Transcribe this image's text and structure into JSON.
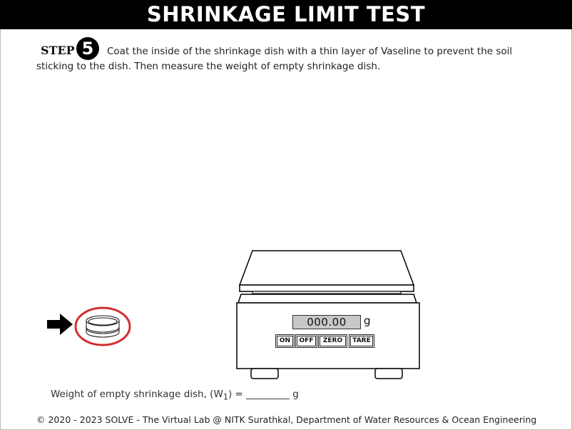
{
  "header": {
    "title": "SHRINKAGE LIMIT TEST"
  },
  "step": {
    "label": "STEP",
    "number": "5",
    "text": "Coat the inside of the shrinkage dish with a thin layer of Vaseline to prevent the soil sticking to the dish. Then measure the weight of empty shrinkage dish."
  },
  "scale": {
    "display_value": "000.00",
    "unit": "g",
    "buttons": {
      "on": "ON",
      "off": "OFF",
      "zero": "ZERO",
      "tare": "TARE"
    }
  },
  "weight": {
    "label": "Weight of empty shrinkage dish, (W",
    "subscript": "1",
    "equals": ") = ",
    "blank": "_________",
    "unit": " g"
  },
  "footer": {
    "text": "© 2020 - 2023 SOLVE - The Virtual Lab @ NITK Surathkal, Department of Water Resources & Ocean Engineering"
  },
  "colors": {
    "highlight_ring": "#d32f2f",
    "display_bg": "#c8c8c8"
  },
  "icons": {
    "pointer": "right-arrow-icon",
    "dish": "shrinkage-dish-icon"
  }
}
